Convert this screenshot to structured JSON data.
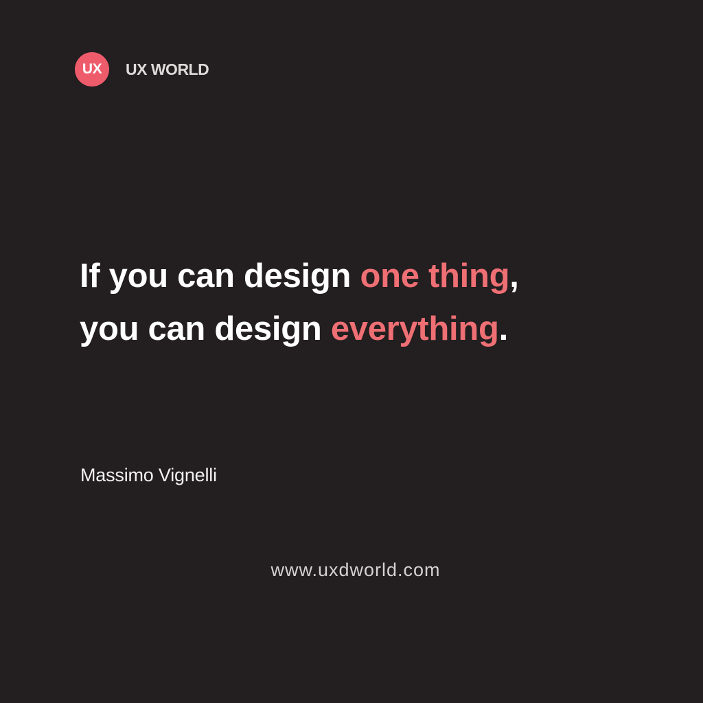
{
  "brand": {
    "logo_text": "UX",
    "name": "UX WORLD"
  },
  "quote": {
    "line1": {
      "part1": "If you can design ",
      "accent": "one thing",
      "part2": ","
    },
    "line2": {
      "part1": "you can design ",
      "accent": "everything",
      "part2": "."
    }
  },
  "author": "Massimo Vignelli",
  "website": "www.uxdworld.com",
  "colors": {
    "background": "#231e1f",
    "accent": "#ee6f74",
    "logo_circle": "#ee5c6c",
    "text": "#ffffff"
  }
}
